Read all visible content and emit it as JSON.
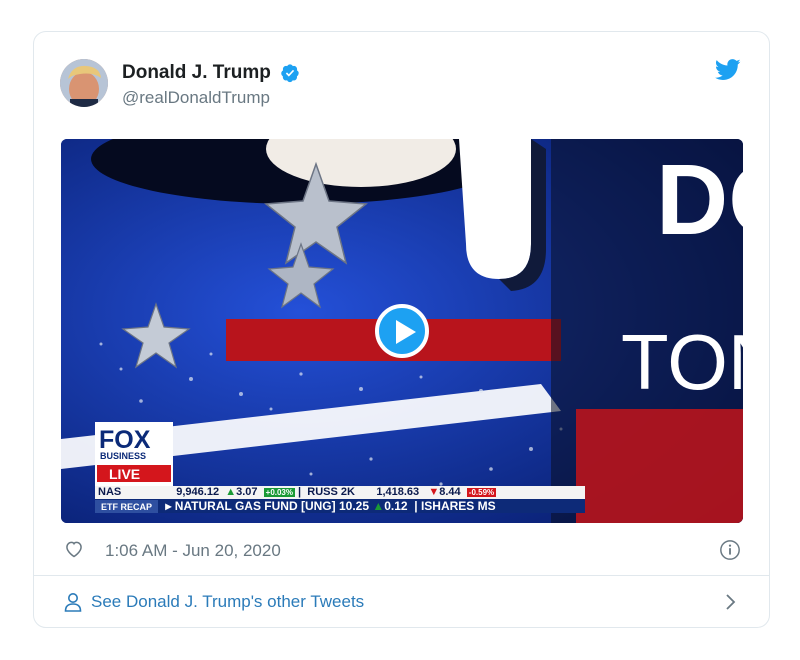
{
  "tweet": {
    "display_name": "Donald J. Trump",
    "handle": "@realDonaldTrump",
    "timestamp": "1:06 AM - Jun 20, 2020",
    "footer_link": "See Donald J. Trump's other Tweets"
  },
  "video": {
    "logo_line1": "FOX",
    "logo_line2": "BUSINESS",
    "logo_live": "LIVE",
    "ticker_row1": {
      "nas_label": "NAS",
      "nas_value": "9,946.12",
      "nas_change": "3.07",
      "nas_pct": "+0.03%",
      "russ_label": "RUSS 2K",
      "russ_value": "1,418.63",
      "russ_change": "8.44",
      "russ_pct": "-0.59%"
    },
    "ticker_row2": {
      "section": "ETF RECAP",
      "item": "NATURAL GAS FUND",
      "symbol": "UNG",
      "price": "10.25",
      "change": "0.12",
      "next": "ISHARES MS"
    },
    "set_text_1": "DO",
    "set_text_2": "TON"
  },
  "colors": {
    "twitter_blue": "#1da1f2",
    "link_blue": "#2b7bb9",
    "muted_gray": "#697882",
    "border_gray": "#e1e8ed"
  },
  "icons": {
    "verified": "verified-badge-icon",
    "bird": "twitter-bird-icon",
    "play": "play-icon",
    "heart": "heart-icon",
    "info": "info-icon",
    "person": "person-icon",
    "chevron": "chevron-right-icon"
  }
}
